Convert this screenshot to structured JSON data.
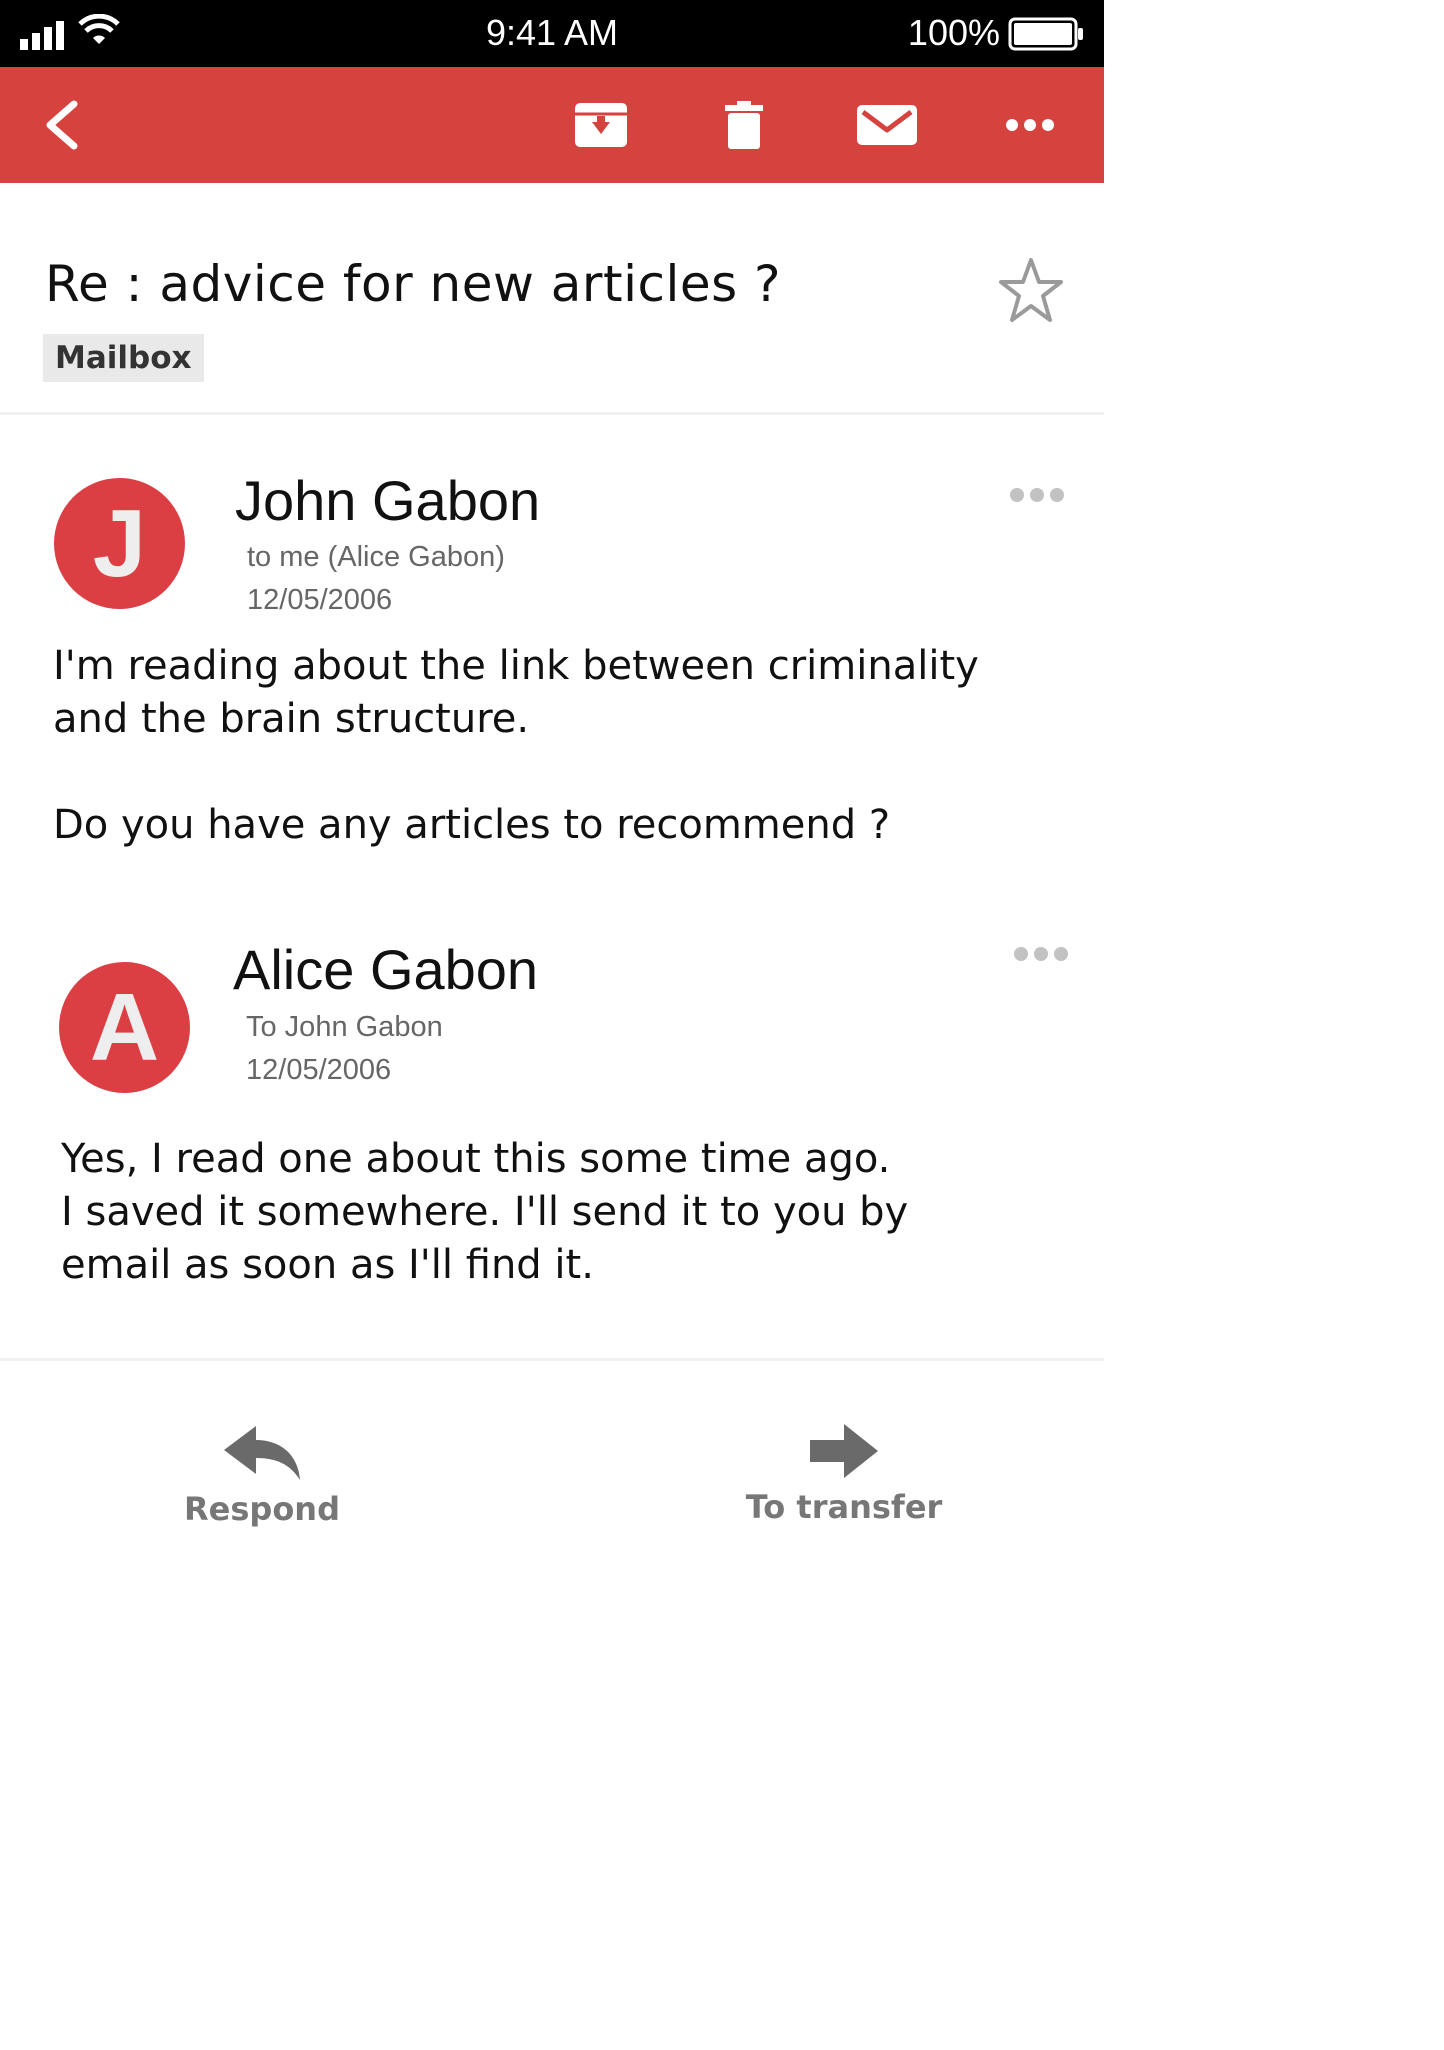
{
  "status_bar": {
    "time": "9:41 AM",
    "battery": "100%"
  },
  "toolbar": {
    "icons": [
      "back-arrow-icon",
      "archive-icon",
      "trash-icon",
      "mail-icon",
      "more-icon"
    ]
  },
  "colors": {
    "accent": "#d6423e",
    "avatar": "#dc3f43"
  },
  "email": {
    "subject": "Re : advice for new articles ?",
    "label": "Mailbox"
  },
  "messages": [
    {
      "avatar_letter": "J",
      "sender": "John Gabon",
      "recipient": "to me (Alice Gabon)",
      "date": "12/05/2006",
      "body": "I'm reading about the link between criminality\nand the brain structure.\n\nDo you have any articles to recommend ?"
    },
    {
      "avatar_letter": "A",
      "sender": "Alice Gabon",
      "recipient": "To John Gabon",
      "date": "12/05/2006",
      "body": "Yes, I read one about this some time ago.\nI saved it somewhere. I'll send it to you by\nemail as soon as I'll find it."
    }
  ],
  "actions": {
    "respond": "Respond",
    "transfer": "To transfer"
  }
}
